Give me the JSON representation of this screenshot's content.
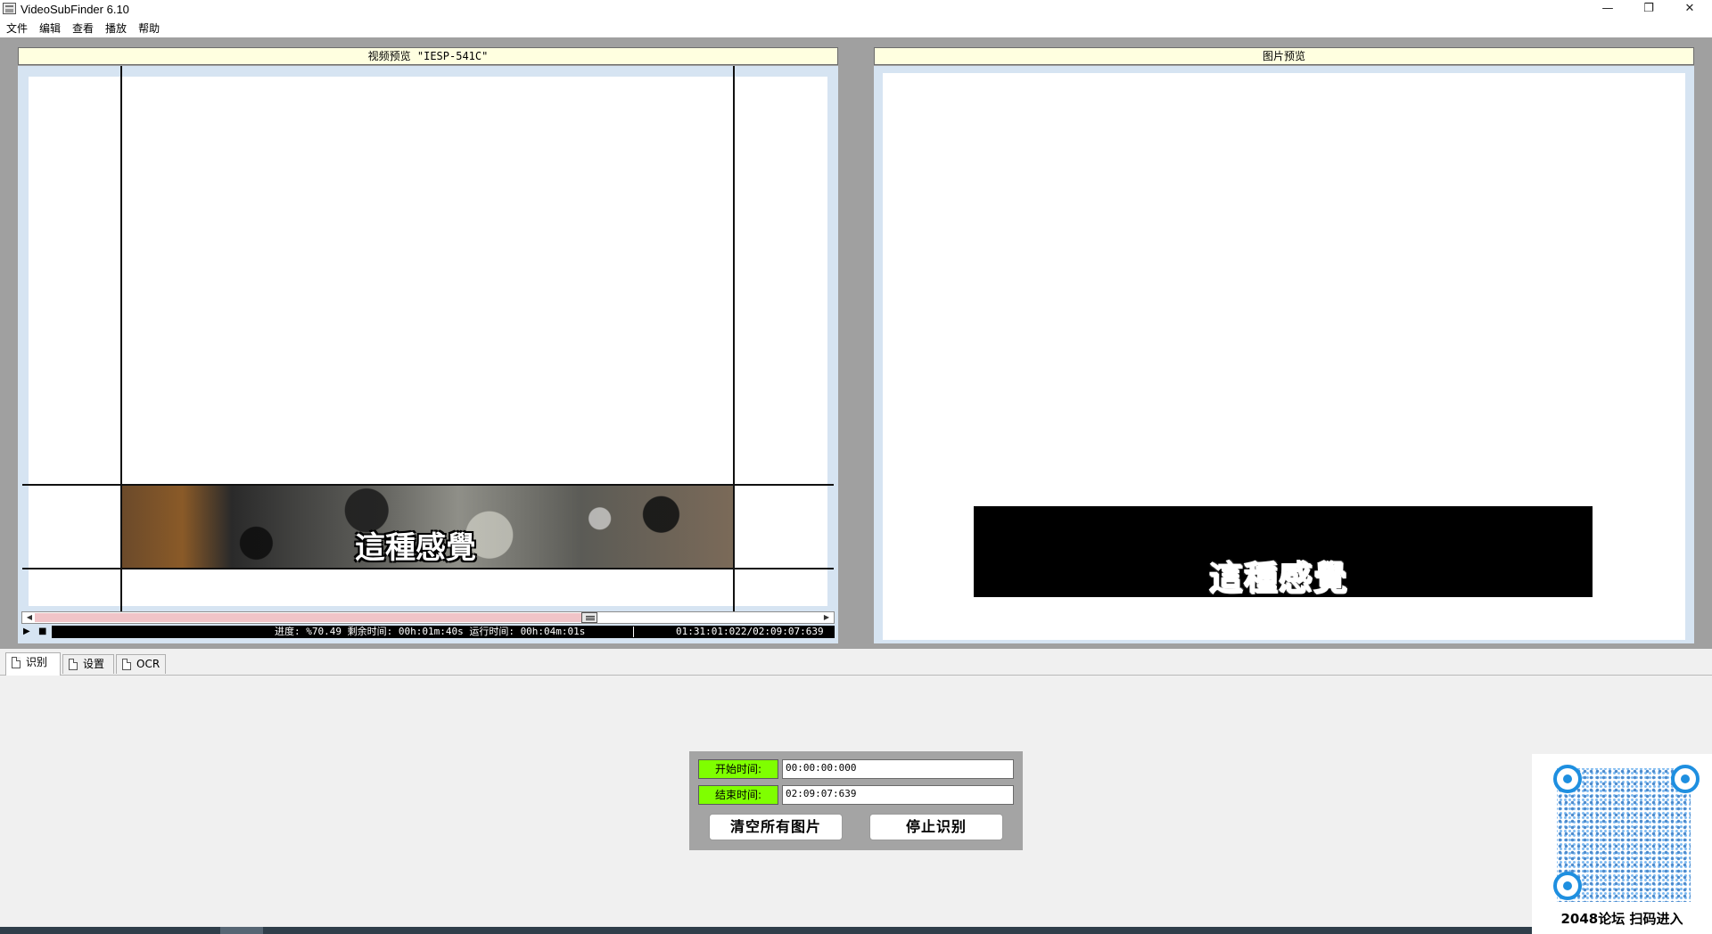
{
  "window": {
    "title": "VideoSubFinder 6.10",
    "minimize_glyph": "—",
    "restore_glyph": "❐",
    "close_glyph": "✕"
  },
  "menu": [
    "文件",
    "编辑",
    "查看",
    "播放",
    "帮助"
  ],
  "video_panel": {
    "title": "视频预览 \"IESP-541C\"",
    "subtitle_text": "這種感覺"
  },
  "image_panel": {
    "title": "图片预览",
    "subtitle_text": "這種感覺"
  },
  "playback": {
    "progress_fraction": 0.7049,
    "play_glyph": "▶",
    "stop_glyph": "■",
    "left_arrow": "◀",
    "right_arrow": "▶",
    "status_text": "进度: %70.49 剩余时间: 00h:01m:40s 运行时间: 00h:04m:01s",
    "time_position": "01:31:01:022/02:09:07:639"
  },
  "tabs": [
    {
      "label": "识别",
      "active": true
    },
    {
      "label": "设置",
      "active": false
    },
    {
      "label": "OCR",
      "active": false
    }
  ],
  "recognition": {
    "start_label": "开始时间:",
    "start_value": "00:00:00:000",
    "end_label": "结束时间:",
    "end_value": "02:09:07:639",
    "clear_button": "清空所有图片",
    "stop_button": "停止识别"
  },
  "overlay": {
    "qr_caption": "2048论坛 扫码进入"
  },
  "colors": {
    "panel_header_bg": "#ffffe0",
    "time_label_bg": "#7fff00",
    "progress_fill": "#f0c4c8",
    "qr_blue": "#1e8fe0"
  }
}
